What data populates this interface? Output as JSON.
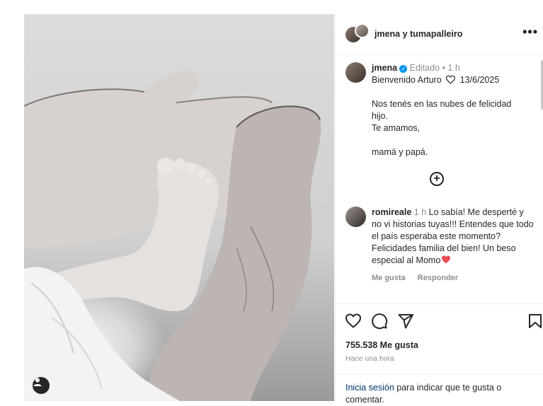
{
  "header": {
    "names": "jmena y tumapalleiro",
    "more": "•••"
  },
  "caption": {
    "username": "jmena",
    "verified_mark": "✓",
    "edited": "Editado",
    "dot": "•",
    "age": "1 h",
    "first_line": "Bienvenido Arturo",
    "date": "13/6/2025",
    "body": "Nos tenés en las nubes de felicidad\nhijo.\nTe amamos,\n\nmamá y papá."
  },
  "load_more_symbol": "+",
  "comment": {
    "username": "romireale",
    "age": "1 h",
    "text": "Lo sabía! Me desperté y no vi historias tuyas!!! Entendes que todo el país esperaba este momento? Felicidades familia del bien! Un beso especial al Momo",
    "like_label": "Me gusta",
    "reply_label": "Responder"
  },
  "footer": {
    "likes": "755.538 Me gusta",
    "time": "Hace una hora",
    "login_link": "Inicia sesión",
    "login_rest": " para indicar que te gusta o comentar."
  },
  "colors": {
    "verified": "#0095f6",
    "heart": "#ed4956",
    "link": "#00376b"
  },
  "icons": [
    "heart-outline-icon",
    "comment-icon",
    "share-icon",
    "save-icon",
    "plus-circle-icon",
    "heart-emoji-icon",
    "user-tag-icon"
  ]
}
